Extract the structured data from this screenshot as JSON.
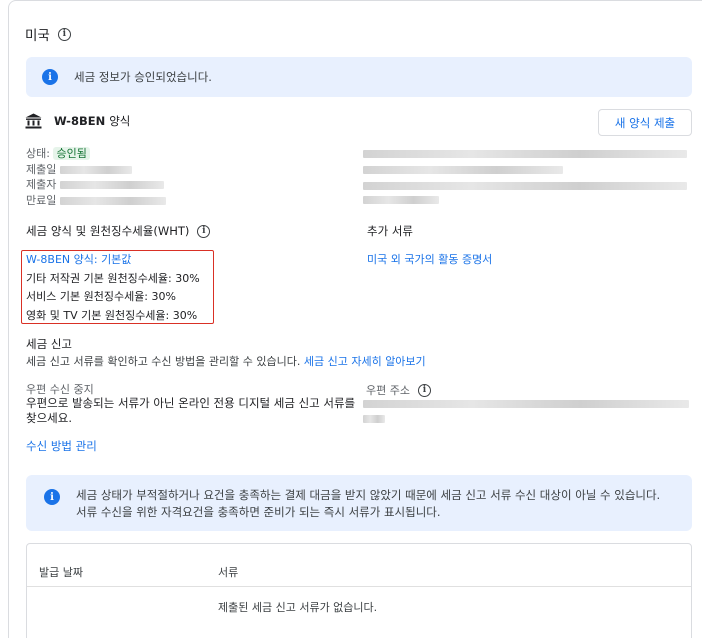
{
  "section": {
    "title": "미국"
  },
  "approved_banner": {
    "text": "세금 정보가 승인되었습니다."
  },
  "form": {
    "name": "W-8BEN",
    "name_suffix": "양식",
    "new_form_button": "새 양식 제출"
  },
  "details": {
    "status_label": "상태:",
    "status_value": "승인됨",
    "submitted_label": "제출일",
    "submitter_label": "제출자",
    "expiry_label": "만료일"
  },
  "wht": {
    "title": "세금 양식 및 원천징수세율(WHT)",
    "default_link": "W-8BEN 양식: 기본값",
    "rates": [
      "기타 저작권 기본 원천징수세율: 30%",
      "서비스 기본 원천징수세율: 30%",
      "영화 및 TV 기본 원천징수세율: 30%"
    ]
  },
  "additional_docs": {
    "title": "추가 서류",
    "link": "미국 외 국가의 활동 증명서"
  },
  "tax_filing": {
    "title": "세금 신고",
    "desc": "세금 신고 서류를 확인하고 수신 방법을 관리할 수 있습니다.",
    "learn_more": "세금 신고 자세히 알아보기"
  },
  "mail_stop": {
    "title": "우편 수신 중지",
    "desc": "우편으로 발송되는 서류가 아닌 온라인 전용 디지털 세금 신고 서류를 찾으세요."
  },
  "manage_link": "수신 방법 관리",
  "mail_address": {
    "title": "우편 주소"
  },
  "eligibility_banner": {
    "text": "세금 상태가 부적절하거나 요건을 충족하는 결제 대금을 받지 않았기 때문에 세금 신고 서류 수신 대상이 아닐 수 있습니다. 서류 수신을 위한 자격요건을 충족하면 준비가 되는 즉시 서류가 표시됩니다."
  },
  "table": {
    "columns": [
      "발급 날짜",
      "서류"
    ],
    "empty_message": "제출된 세금 신고 서류가 없습니다."
  },
  "colors": {
    "accent": "#1a73e8",
    "banner_bg": "#e8f0fe",
    "status_bg": "#e6f4ea",
    "status_text": "#137333",
    "highlight_border": "#d93025"
  },
  "icons": [
    "info-icon",
    "bank-icon"
  ]
}
